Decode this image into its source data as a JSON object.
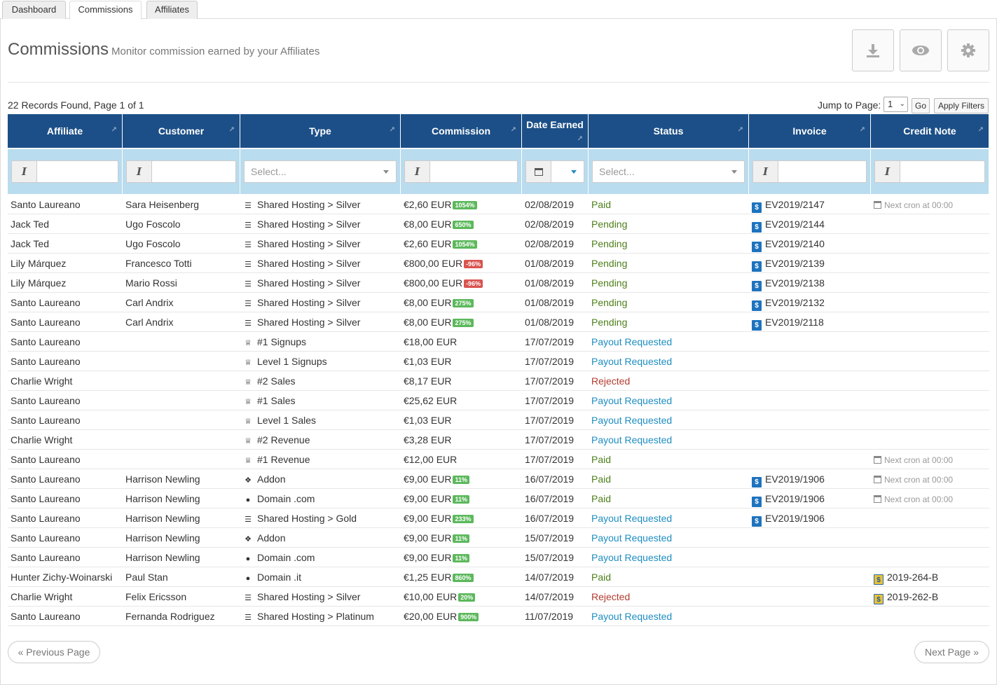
{
  "tabs": [
    {
      "label": "Dashboard"
    },
    {
      "label": "Commissions"
    },
    {
      "label": "Affiliates"
    }
  ],
  "header": {
    "title": "Commissions",
    "subtitle": "Monitor commission earned by your Affiliates",
    "tools": [
      "download-icon",
      "eye-icon",
      "gear-icon"
    ]
  },
  "records_text": "22 Records Found, Page 1 of 1",
  "jump": {
    "label": "Jump to Page:",
    "value": "1",
    "go": "Go",
    "apply": "Apply Filters"
  },
  "columns": [
    "Affiliate",
    "Customer",
    "Type",
    "Commission",
    "Date Earned",
    "Status",
    "Invoice",
    "Credit Note"
  ],
  "filters": {
    "type_placeholder": "Select...",
    "status_placeholder": "Select..."
  },
  "colors": {
    "header_bg": "#1c4f87",
    "filter_bg": "#b9dcee",
    "paid": "#4d7f1a",
    "payout_requested": "#1e8dc1",
    "rejected": "#b23c2f",
    "badge_positive": "#5cb85c",
    "badge_negative": "#d9534f"
  },
  "rows": [
    {
      "affiliate": "Santo Laureano",
      "customer": "Sara Heisenberg",
      "type_icon": "list-icon",
      "type": "Shared Hosting > Silver",
      "commission": "€2,60 EUR",
      "badge": "1054%",
      "badge_type": "pos",
      "date": "02/08/2019",
      "status": "Paid",
      "invoice": "EV2019/2147",
      "credit_note": "Next cron at 00:00",
      "cn_type": "cron"
    },
    {
      "affiliate": "Jack Ted",
      "customer": "Ugo Foscolo",
      "type_icon": "list-icon",
      "type": "Shared Hosting > Silver",
      "commission": "€8,00 EUR",
      "badge": "650%",
      "badge_type": "pos",
      "date": "02/08/2019",
      "status": "Pending",
      "invoice": "EV2019/2144",
      "credit_note": "",
      "cn_type": ""
    },
    {
      "affiliate": "Jack Ted",
      "customer": "Ugo Foscolo",
      "type_icon": "list-icon",
      "type": "Shared Hosting > Silver",
      "commission": "€2,60 EUR",
      "badge": "1054%",
      "badge_type": "pos",
      "date": "02/08/2019",
      "status": "Pending",
      "invoice": "EV2019/2140",
      "credit_note": "",
      "cn_type": ""
    },
    {
      "affiliate": "Lily Márquez",
      "customer": "Francesco Totti",
      "type_icon": "list-icon",
      "type": "Shared Hosting > Silver",
      "commission": "€800,00 EUR",
      "badge": "-96%",
      "badge_type": "neg",
      "date": "01/08/2019",
      "status": "Pending",
      "invoice": "EV2019/2139",
      "credit_note": "",
      "cn_type": ""
    },
    {
      "affiliate": "Lily Márquez",
      "customer": "Mario Rossi",
      "type_icon": "list-icon",
      "type": "Shared Hosting > Silver",
      "commission": "€800,00 EUR",
      "badge": "-96%",
      "badge_type": "neg",
      "date": "01/08/2019",
      "status": "Pending",
      "invoice": "EV2019/2138",
      "credit_note": "",
      "cn_type": ""
    },
    {
      "affiliate": "Santo Laureano",
      "customer": "Carl Andrix",
      "type_icon": "list-icon",
      "type": "Shared Hosting > Silver",
      "commission": "€8,00 EUR",
      "badge": "275%",
      "badge_type": "pos",
      "date": "01/08/2019",
      "status": "Pending",
      "invoice": "EV2019/2132",
      "credit_note": "",
      "cn_type": ""
    },
    {
      "affiliate": "Santo Laureano",
      "customer": "Carl Andrix",
      "type_icon": "list-icon",
      "type": "Shared Hosting > Silver",
      "commission": "€8,00 EUR",
      "badge": "275%",
      "badge_type": "pos",
      "date": "01/08/2019",
      "status": "Pending",
      "invoice": "EV2019/2118",
      "credit_note": "",
      "cn_type": ""
    },
    {
      "affiliate": "Santo Laureano",
      "customer": "",
      "type_icon": "trophy-icon",
      "type": "#1 Signups",
      "commission": "€18,00 EUR",
      "badge": "",
      "badge_type": "",
      "date": "17/07/2019",
      "status": "Payout Requested",
      "invoice": "",
      "credit_note": "",
      "cn_type": ""
    },
    {
      "affiliate": "Santo Laureano",
      "customer": "",
      "type_icon": "trophy-icon",
      "type": "Level 1 Signups",
      "commission": "€1,03 EUR",
      "badge": "",
      "badge_type": "",
      "date": "17/07/2019",
      "status": "Payout Requested",
      "invoice": "",
      "credit_note": "",
      "cn_type": ""
    },
    {
      "affiliate": "Charlie Wright",
      "customer": "",
      "type_icon": "trophy-icon",
      "type": "#2 Sales",
      "commission": "€8,17 EUR",
      "badge": "",
      "badge_type": "",
      "date": "17/07/2019",
      "status": "Rejected",
      "invoice": "",
      "credit_note": "",
      "cn_type": ""
    },
    {
      "affiliate": "Santo Laureano",
      "customer": "",
      "type_icon": "trophy-icon",
      "type": "#1 Sales",
      "commission": "€25,62 EUR",
      "badge": "",
      "badge_type": "",
      "date": "17/07/2019",
      "status": "Payout Requested",
      "invoice": "",
      "credit_note": "",
      "cn_type": ""
    },
    {
      "affiliate": "Santo Laureano",
      "customer": "",
      "type_icon": "trophy-icon",
      "type": "Level 1 Sales",
      "commission": "€1,03 EUR",
      "badge": "",
      "badge_type": "",
      "date": "17/07/2019",
      "status": "Payout Requested",
      "invoice": "",
      "credit_note": "",
      "cn_type": ""
    },
    {
      "affiliate": "Charlie Wright",
      "customer": "",
      "type_icon": "trophy-icon",
      "type": "#2 Revenue",
      "commission": "€3,28 EUR",
      "badge": "",
      "badge_type": "",
      "date": "17/07/2019",
      "status": "Payout Requested",
      "invoice": "",
      "credit_note": "",
      "cn_type": ""
    },
    {
      "affiliate": "Santo Laureano",
      "customer": "",
      "type_icon": "trophy-icon",
      "type": "#1 Revenue",
      "commission": "€12,00 EUR",
      "badge": "",
      "badge_type": "",
      "date": "17/07/2019",
      "status": "Paid",
      "invoice": "",
      "credit_note": "Next cron at 00:00",
      "cn_type": "cron"
    },
    {
      "affiliate": "Santo Laureano",
      "customer": "Harrison Newling",
      "type_icon": "puzzle-icon",
      "type": "Addon",
      "commission": "€9,00 EUR",
      "badge": "11%",
      "badge_type": "pos",
      "date": "16/07/2019",
      "status": "Paid",
      "invoice": "EV2019/1906",
      "credit_note": "Next cron at 00:00",
      "cn_type": "cron"
    },
    {
      "affiliate": "Santo Laureano",
      "customer": "Harrison Newling",
      "type_icon": "globe-icon",
      "type": "Domain .com",
      "commission": "€9,00 EUR",
      "badge": "11%",
      "badge_type": "pos",
      "date": "16/07/2019",
      "status": "Paid",
      "invoice": "EV2019/1906",
      "credit_note": "Next cron at 00:00",
      "cn_type": "cron"
    },
    {
      "affiliate": "Santo Laureano",
      "customer": "Harrison Newling",
      "type_icon": "list-icon",
      "type": "Shared Hosting > Gold",
      "commission": "€9,00 EUR",
      "badge": "233%",
      "badge_type": "pos",
      "date": "16/07/2019",
      "status": "Payout Requested",
      "invoice": "EV2019/1906",
      "credit_note": "",
      "cn_type": ""
    },
    {
      "affiliate": "Santo Laureano",
      "customer": "Harrison Newling",
      "type_icon": "puzzle-icon",
      "type": "Addon",
      "commission": "€9,00 EUR",
      "badge": "11%",
      "badge_type": "pos",
      "date": "15/07/2019",
      "status": "Payout Requested",
      "invoice": "",
      "credit_note": "",
      "cn_type": ""
    },
    {
      "affiliate": "Santo Laureano",
      "customer": "Harrison Newling",
      "type_icon": "globe-icon",
      "type": "Domain .com",
      "commission": "€9,00 EUR",
      "badge": "11%",
      "badge_type": "pos",
      "date": "15/07/2019",
      "status": "Payout Requested",
      "invoice": "",
      "credit_note": "",
      "cn_type": ""
    },
    {
      "affiliate": "Hunter Zichy-Woinarski",
      "customer": "Paul Stan",
      "type_icon": "globe-icon",
      "type": "Domain .it",
      "commission": "€1,25 EUR",
      "badge": "860%",
      "badge_type": "pos",
      "date": "14/07/2019",
      "status": "Paid",
      "invoice": "",
      "credit_note": "2019-264-B",
      "cn_type": "note"
    },
    {
      "affiliate": "Charlie Wright",
      "customer": "Felix Ericsson",
      "type_icon": "list-icon",
      "type": "Shared Hosting > Silver",
      "commission": "€10,00 EUR",
      "badge": "20%",
      "badge_type": "pos",
      "date": "14/07/2019",
      "status": "Rejected",
      "invoice": "",
      "credit_note": "2019-262-B",
      "cn_type": "note"
    },
    {
      "affiliate": "Santo Laureano",
      "customer": "Fernanda Rodriguez",
      "type_icon": "list-icon",
      "type": "Shared Hosting > Platinum",
      "commission": "€20,00 EUR",
      "badge": "900%",
      "badge_type": "pos",
      "date": "11/07/2019",
      "status": "Payout Requested",
      "invoice": "",
      "credit_note": "",
      "cn_type": ""
    }
  ],
  "pagination": {
    "prev": "« Previous Page",
    "next": "Next Page »"
  }
}
